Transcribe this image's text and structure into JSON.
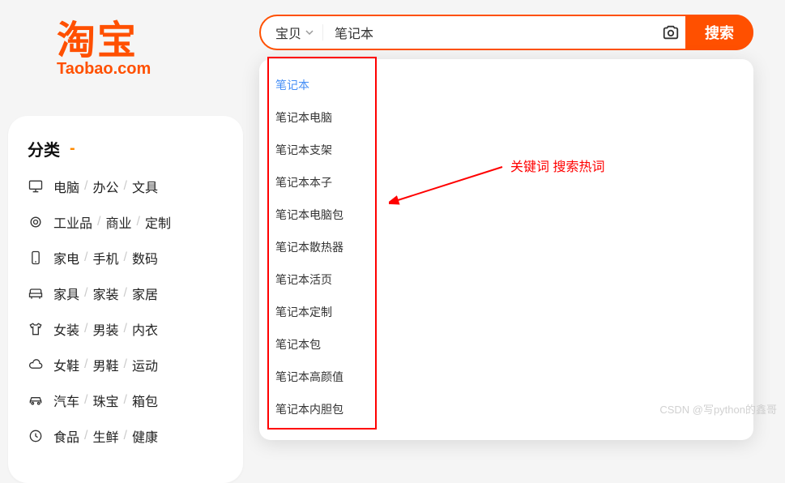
{
  "logo": {
    "text": "淘宝",
    "sub": "Taobao.com"
  },
  "categories": {
    "title": "分类",
    "rows": [
      {
        "icon": "monitor",
        "items": [
          "电脑",
          "办公",
          "文具"
        ]
      },
      {
        "icon": "gear",
        "items": [
          "工业品",
          "商业",
          "定制"
        ]
      },
      {
        "icon": "phone",
        "items": [
          "家电",
          "手机",
          "数码"
        ]
      },
      {
        "icon": "sofa",
        "items": [
          "家具",
          "家装",
          "家居"
        ]
      },
      {
        "icon": "shirt",
        "items": [
          "女装",
          "男装",
          "内衣"
        ]
      },
      {
        "icon": "cloud",
        "items": [
          "女鞋",
          "男鞋",
          "运动"
        ]
      },
      {
        "icon": "car",
        "items": [
          "汽车",
          "珠宝",
          "箱包"
        ]
      },
      {
        "icon": "clock",
        "items": [
          "食品",
          "生鲜",
          "健康"
        ]
      }
    ]
  },
  "search": {
    "type_label": "宝贝",
    "input_value": "笔记本",
    "button_label": "搜索",
    "suggestions": [
      "笔记本",
      "笔记本电脑",
      "笔记本支架",
      "笔记本本子",
      "笔记本电脑包",
      "笔记本散热器",
      "笔记本活页",
      "笔记本定制",
      "笔记本包",
      "笔记本高颜值",
      "笔记本内胆包"
    ]
  },
  "annotation": {
    "label": "关键词 搜索热词"
  },
  "watermark": "CSDN @写python的鑫哥"
}
